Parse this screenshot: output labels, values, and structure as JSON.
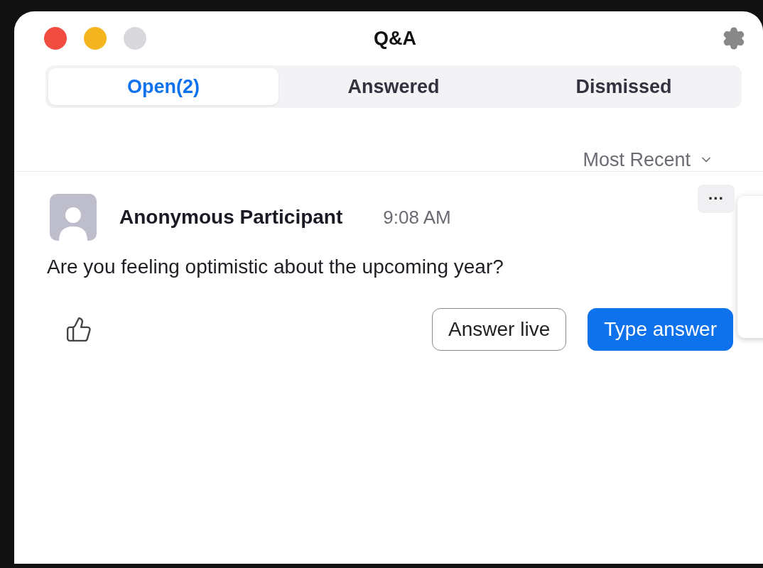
{
  "window": {
    "title": "Q&A"
  },
  "tabs": [
    {
      "label": "Open(2)",
      "selected": true
    },
    {
      "label": "Answered",
      "selected": false
    },
    {
      "label": "Dismissed",
      "selected": false
    }
  ],
  "sort": {
    "label": "Most Recent"
  },
  "questions": [
    {
      "author": "Anonymous Participant",
      "time": "9:08 AM",
      "text": "Are you feeling optimistic about the upcoming year?",
      "more": "···",
      "buttons": [
        {
          "label": "Answer live",
          "kind": "outline"
        },
        {
          "label": "Type answer",
          "kind": "primary"
        }
      ]
    }
  ]
}
